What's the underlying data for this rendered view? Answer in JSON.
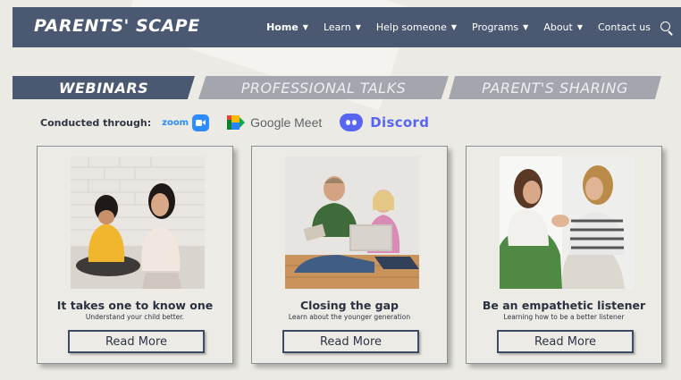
{
  "header": {
    "brand": "PARENTS' SCAPE",
    "nav": [
      {
        "label": "Home",
        "caret": "▼",
        "active": true
      },
      {
        "label": "Learn",
        "caret": "▼"
      },
      {
        "label": "Help someone",
        "caret": "▼"
      },
      {
        "label": "Programs",
        "caret": "▼"
      },
      {
        "label": "About",
        "caret": "▼"
      },
      {
        "label": "Contact us"
      }
    ],
    "search_icon": "search-icon"
  },
  "tabs": [
    {
      "label": "WEBINARS",
      "active": true
    },
    {
      "label": "PROFESSIONAL TALKS"
    },
    {
      "label": "PARENT'S SHARING"
    }
  ],
  "conducted": {
    "label": "Conducted through:",
    "platforms": {
      "zoom": "zoom",
      "google_meet": "Google Meet",
      "discord": "Discord"
    }
  },
  "cards": [
    {
      "title": "It takes one to know one",
      "subtitle": "Understand your child better.",
      "button": "Read More"
    },
    {
      "title": "Closing the gap",
      "subtitle": "Learn about the younger generation",
      "button": "Read More"
    },
    {
      "title": "Be an empathetic listener",
      "subtitle": "Learning how to be a better listener",
      "button": "Read More"
    }
  ],
  "colors": {
    "navbar": "#4a5872",
    "background": "#eceae4",
    "tab_inactive": "#a3a7ad",
    "zoom": "#2d8cff",
    "discord": "#5865f2"
  }
}
